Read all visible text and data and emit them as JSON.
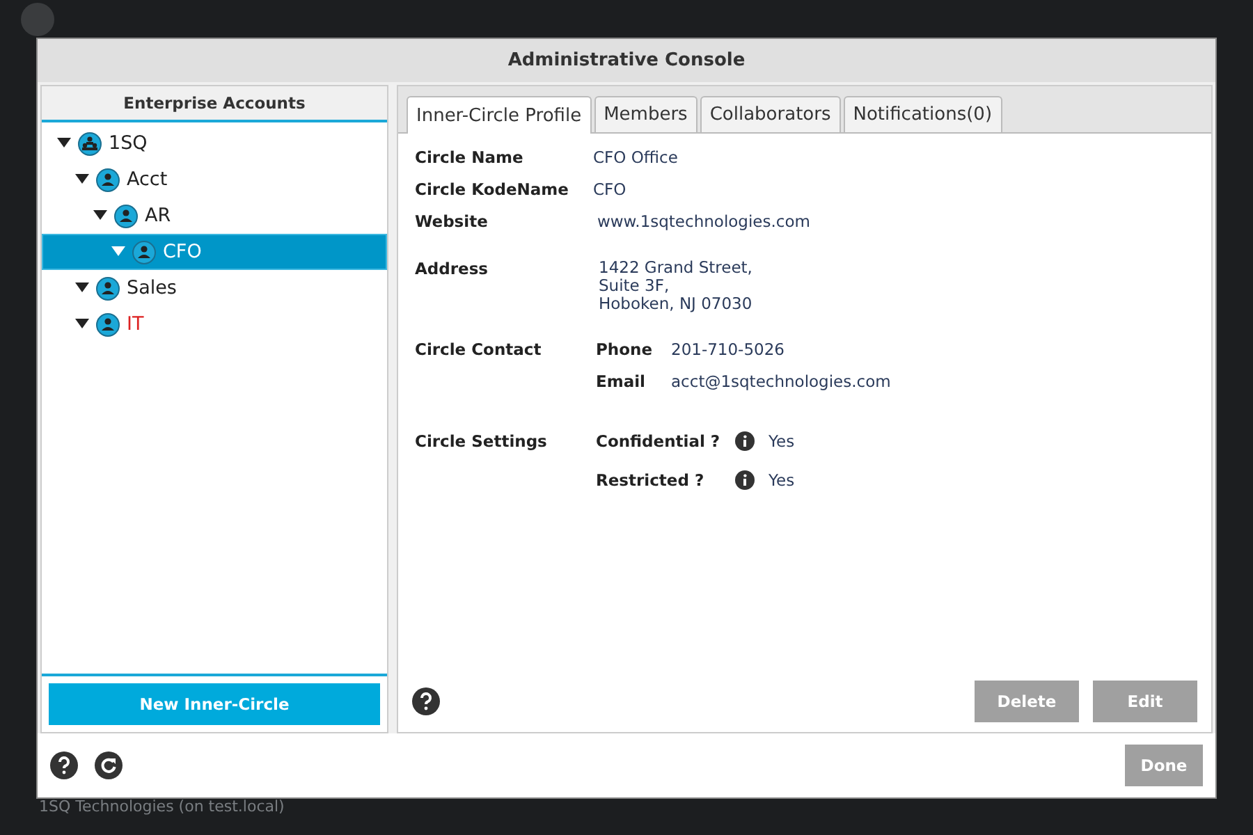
{
  "background": {
    "status_text": "1SQ Technologies (on test.local)"
  },
  "dialog": {
    "title": "Administrative Console"
  },
  "accounts": {
    "heading": "Enterprise Accounts",
    "tree": [
      {
        "label": "1SQ",
        "kind": "root",
        "expanded": true,
        "selected": false,
        "color": "#222222",
        "children": [
          {
            "label": "Acct",
            "kind": "circle",
            "expanded": true,
            "selected": false,
            "color": "#222222",
            "children": [
              {
                "label": "AR",
                "kind": "circle",
                "expanded": true,
                "selected": false,
                "color": "#222222",
                "children": [
                  {
                    "label": "CFO",
                    "kind": "circle",
                    "expanded": true,
                    "selected": true,
                    "color": "#ffffff"
                  }
                ]
              }
            ]
          },
          {
            "label": "Sales",
            "kind": "circle",
            "expanded": true,
            "selected": false,
            "color": "#222222"
          },
          {
            "label": "IT",
            "kind": "circle",
            "expanded": true,
            "selected": false,
            "color": "#dd2222"
          }
        ]
      }
    ],
    "new_button": "New Inner-Circle"
  },
  "tabs": [
    {
      "label": "Inner-Circle Profile",
      "selected": true
    },
    {
      "label": "Members",
      "selected": false
    },
    {
      "label": "Collaborators",
      "selected": false
    },
    {
      "label": "Notifications(0)",
      "selected": false
    }
  ],
  "profile": {
    "circle_name": {
      "label": "Circle Name",
      "value": "CFO Office"
    },
    "kode_name": {
      "label": "Circle KodeName",
      "value": "CFO"
    },
    "website": {
      "label": "Website",
      "value": "www.1sqtechnologies.com"
    },
    "address": {
      "label": "Address",
      "lines": [
        "1422 Grand Street,",
        "Suite 3F,",
        "Hoboken, NJ 07030"
      ]
    },
    "contact": {
      "label": "Circle Contact",
      "rows": [
        {
          "label": "Phone",
          "value": "201-710-5026"
        },
        {
          "label": "Email",
          "value": "acct@1sqtechnologies.com"
        }
      ]
    },
    "settings": {
      "label": "Circle Settings",
      "rows": [
        {
          "label": "Confidential ?",
          "value": "Yes"
        },
        {
          "label": "Restricted ?",
          "value": "Yes"
        }
      ]
    }
  },
  "actions": [
    "Delete",
    "Edit"
  ],
  "footer": {
    "done": "Done"
  }
}
